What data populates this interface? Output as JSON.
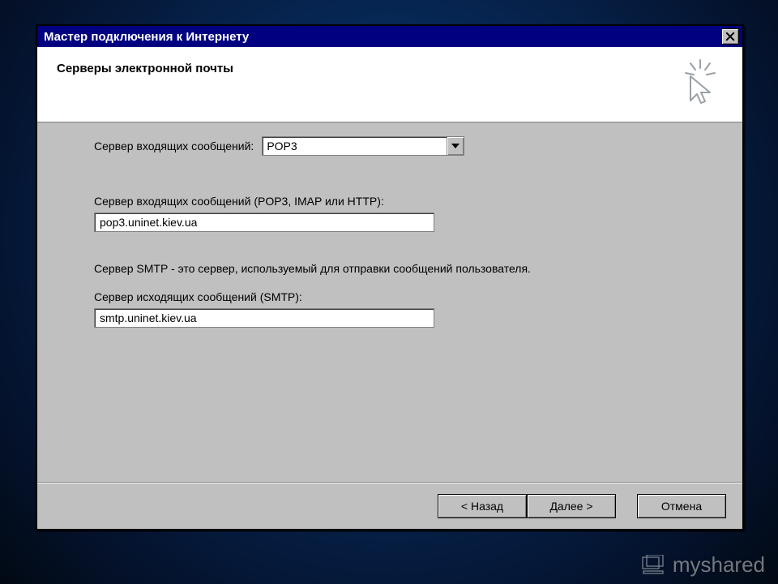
{
  "titlebar": {
    "title": "Мастер подключения к Интернету"
  },
  "header": {
    "subtitle": "Серверы электронной почты"
  },
  "fields": {
    "incoming_type_label": "Сервер входящих сообщений:",
    "incoming_type_value": "POP3",
    "incoming_server_label": "Сервер входящих сообщений (POP3, IMAP или HTTP):",
    "incoming_server_value": "pop3.uninet.kiev.ua",
    "smtp_hint": "Сервер SMTP - это сервер, используемый для отправки сообщений пользователя.",
    "outgoing_server_label": "Сервер исходящих сообщений (SMTP):",
    "outgoing_server_value": "smtp.uninet.kiev.ua"
  },
  "buttons": {
    "back": "< Назад",
    "next": "Далее >",
    "cancel": "Отмена"
  },
  "watermark": "myshared"
}
